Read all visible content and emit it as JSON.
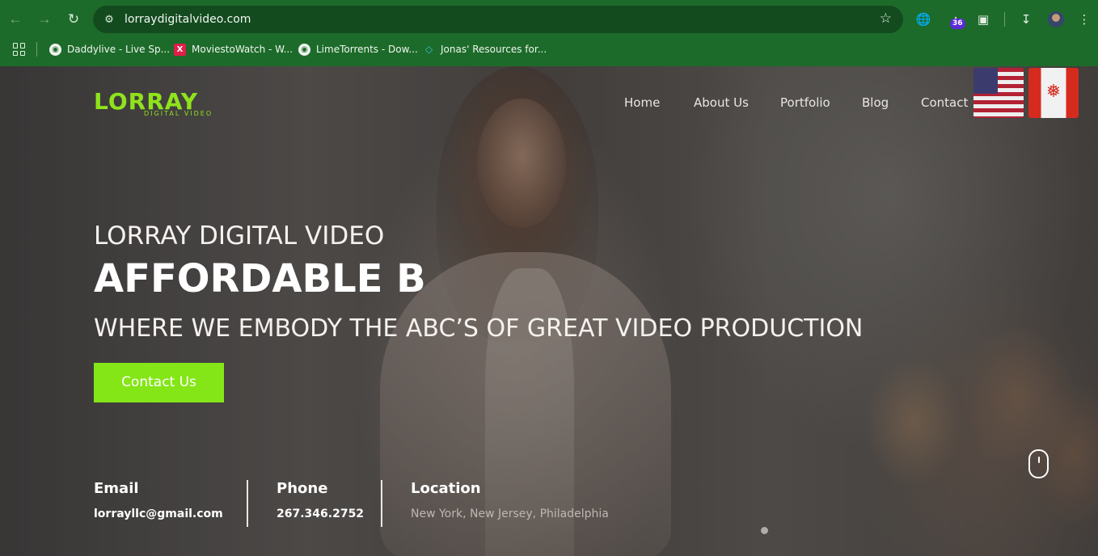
{
  "browser": {
    "url": "lorraydigitalvideo.com",
    "extension_badge": "36",
    "bookmarks": [
      {
        "label": "Daddylive - Live Sp...",
        "icon": "globe-icon"
      },
      {
        "label": "MoviestoWatch - W...",
        "icon": "x-icon"
      },
      {
        "label": "LimeTorrents - Dow...",
        "icon": "globe-icon"
      },
      {
        "label": "Jonas' Resources for...",
        "icon": "gem-icon"
      }
    ]
  },
  "site": {
    "logo_text": "LORRAY",
    "logo_sub": "DIGITAL VIDEO",
    "nav": [
      "Home",
      "About Us",
      "Portfolio",
      "Blog",
      "Contact"
    ],
    "hero": {
      "kicker": "LORRAY DIGITAL VIDEO",
      "title": "AFFORDABLE B",
      "subtitle": "WHERE WE EMBODY THE ABC’S OF GREAT VIDEO PRODUCTION",
      "cta": "Contact Us"
    },
    "info": [
      {
        "label": "Email",
        "value": "lorrayllc@gmail.com"
      },
      {
        "label": "Phone",
        "value": "267.346.2752"
      },
      {
        "label": "Location",
        "value": "New York, New Jersey, Philadelphia"
      }
    ]
  },
  "colors": {
    "chrome": "#1d6b2a",
    "accent": "#84e617",
    "logo": "#8fe31b"
  }
}
